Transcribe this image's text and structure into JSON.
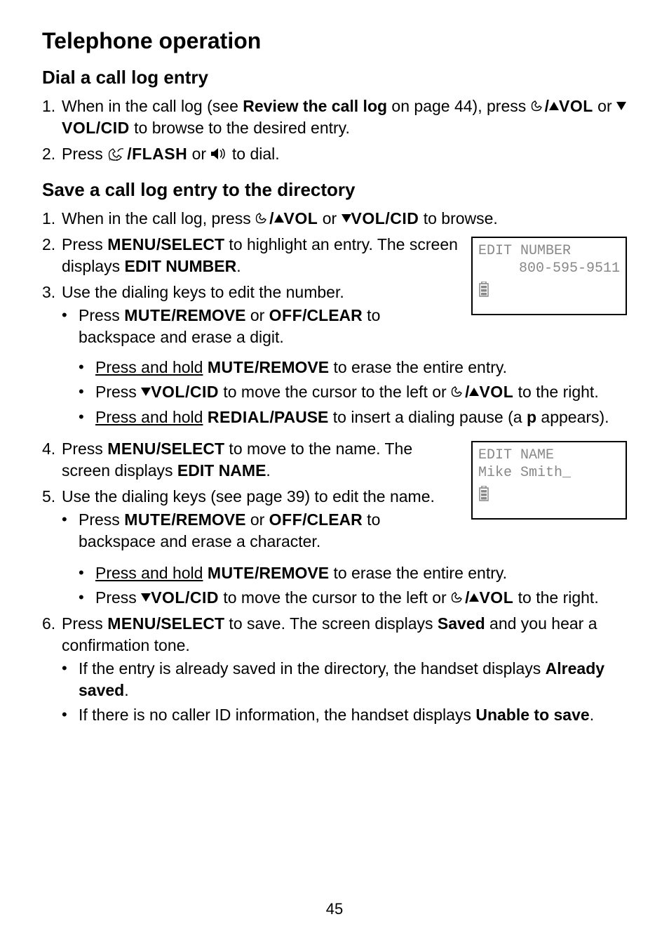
{
  "page_number": "45",
  "h1": "Telephone operation",
  "sectionA": {
    "h2": "Dial a call log entry",
    "items": [
      {
        "num": "1.",
        "t1": "When in the call log (see ",
        "t2": "Review the call log",
        "t3": " on page 44), press ",
        "vol_up": "VOL",
        "t4": " or ",
        "vol_cid": "VOL/CID",
        "t5": " to browse to the desired entry."
      },
      {
        "num": "2.",
        "t1": "Press ",
        "flash": "/FLASH",
        "t2": " or ",
        "t3": " to dial."
      }
    ]
  },
  "sectionB": {
    "h2": "Save a call log entry to the directory",
    "step1": {
      "num": "1.",
      "t1": "When in the call log, press ",
      "vol_up": "VOL",
      "t2": " or ",
      "vol_cid": "VOL/CID",
      "t3": " to browse."
    },
    "step2": {
      "num": "2.",
      "t1": "Press ",
      "menu": "MENU",
      "sel": "/SELECT",
      "t2": " to highlight an entry. The screen displays ",
      "edit_number": "EDIT NUMBER",
      "t3": "."
    },
    "step3": {
      "num": "3.",
      "t1": "Use the dialing keys to edit the number.",
      "b1": {
        "t1": "Press ",
        "mute": "MUTE",
        "rem": "/REMOVE",
        "t2": " or ",
        "off": "OFF",
        "clr": "/CLEAR",
        "t3": " to backspace and erase a digit."
      },
      "b2": {
        "ph": "Press and hold",
        "sp": " ",
        "mute": "MUTE",
        "rem": "/REMOVE",
        "t2": " to erase the entire entry."
      },
      "b3": {
        "t1": "Press ",
        "vol_cid": "VOL/CID",
        "t2": " to move the cursor to the left or ",
        "vol_up": "VOL",
        "t3": " to the right."
      },
      "b4": {
        "ph": "Press and hold",
        "sp": " ",
        "redial": "REDIAL",
        "pause": "/PAUSE",
        "t2": " to insert a dialing pause (a ",
        "p": "p",
        "t3": " appears)."
      }
    },
    "step4": {
      "num": "4.",
      "t1": "Press ",
      "menu": "MENU",
      "sel": "/SELECT",
      "t2": " to move to the name. The screen displays ",
      "edit_name": "EDIT NAME",
      "t3": "."
    },
    "step5": {
      "num": "5.",
      "t1": "Use the dialing keys (see page 39) to edit the name.",
      "b1": {
        "t1": "Press ",
        "mute": "MUTE",
        "rem": "/REMOVE",
        "t2": " or ",
        "off": "OFF",
        "clr": "/CLEAR",
        "t3": " to backspace and erase a character."
      },
      "b2": {
        "ph": "Press and hold",
        "sp": " ",
        "mute": "MUTE",
        "rem": "/REMOVE",
        "t2": " to erase the entire entry."
      },
      "b3": {
        "t1": "Press ",
        "vol_cid": "VOL/CID",
        "t2": " to move the cursor to the left or ",
        "vol_up": "VOL",
        "t3": " to the right."
      }
    },
    "step6": {
      "num": "6.",
      "t1": "Press ",
      "menu": "MENU",
      "sel": "/SELECT",
      "t2": " to save. The screen displays ",
      "saved": "Saved",
      "t3": " and you hear a confirmation tone.",
      "b1": {
        "t1": "If the entry is already saved in the directory, the handset displays ",
        "as": "Already saved",
        "t2": "."
      },
      "b2": {
        "t1": "If there is no caller ID information, the handset displays ",
        "uts": "Unable to save",
        "t2": "."
      }
    }
  },
  "lcd1": {
    "l1": "EDIT NUMBER",
    "l2": "800-595-9511"
  },
  "lcd2": {
    "l1": "EDIT NAME",
    "l2a": "Mike Smith",
    "cursor": "_"
  }
}
